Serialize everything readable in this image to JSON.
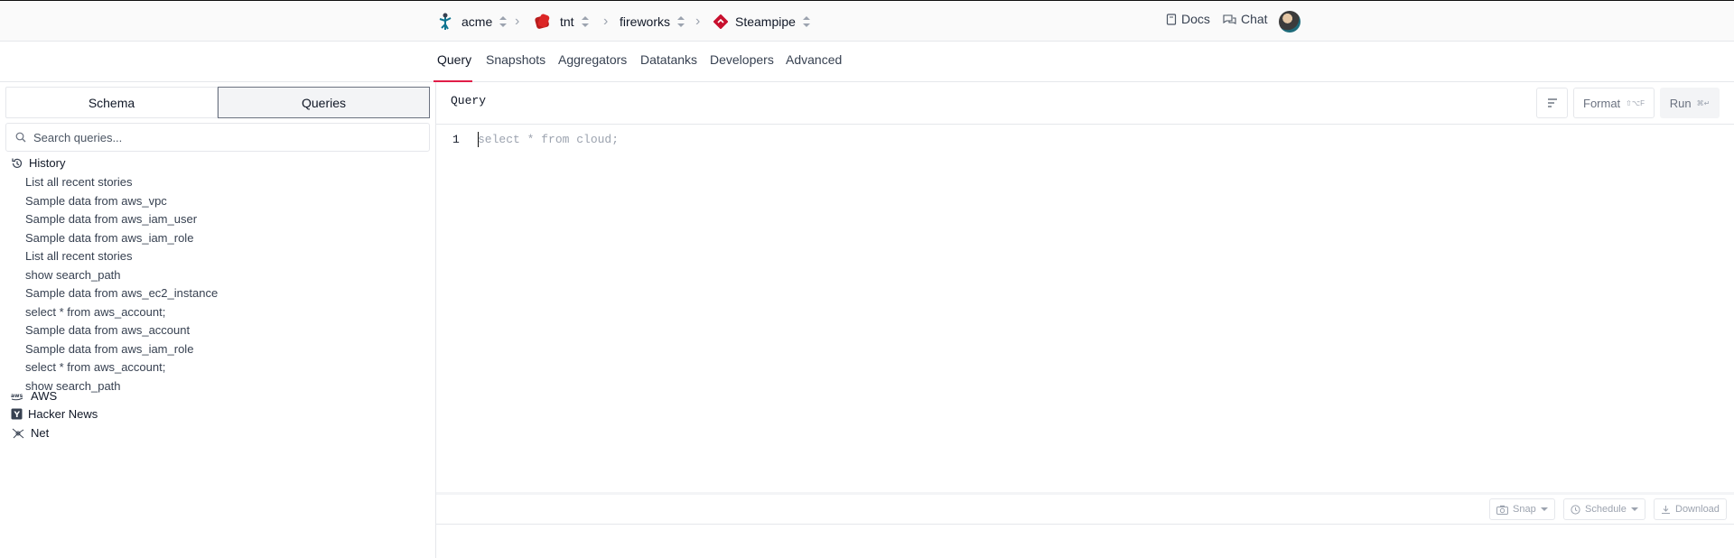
{
  "breadcrumbs": [
    {
      "label": "acme",
      "icon": "acme-logo-icon"
    },
    {
      "label": "tnt",
      "icon": "tnt-logo-icon"
    },
    {
      "label": "fireworks",
      "icon": ""
    },
    {
      "label": "Steampipe",
      "icon": "steampipe-logo-icon"
    }
  ],
  "header": {
    "docs": "Docs",
    "chat": "Chat"
  },
  "tabs": [
    "Query",
    "Snapshots",
    "Aggregators",
    "Datatanks",
    "Developers",
    "Advanced"
  ],
  "sidebar": {
    "segments": {
      "schema": "Schema",
      "queries": "Queries"
    },
    "search_placeholder": "Search queries...",
    "history_label": "History",
    "history": [
      "List all recent stories",
      "Sample data from aws_vpc",
      "Sample data from aws_iam_user",
      "Sample data from aws_iam_role",
      "List all recent stories",
      "show search_path",
      "Sample data from aws_ec2_instance",
      "select * from aws_account;",
      "Sample data from aws_account",
      "Sample data from aws_iam_role",
      "select * from aws_account;",
      "show search_path"
    ],
    "groups": [
      "AWS",
      "Hacker News",
      "Net"
    ]
  },
  "editor": {
    "title": "Query",
    "format_label": "Format",
    "format_shortcut": "⇧⌥F",
    "run_label": "Run",
    "run_shortcut": "⌘↵",
    "line_number": "1",
    "placeholder": "select * from cloud;"
  },
  "results": {
    "snap": "Snap",
    "schedule": "Schedule",
    "download": "Download"
  },
  "colors": {
    "accent": "#e11d48"
  }
}
